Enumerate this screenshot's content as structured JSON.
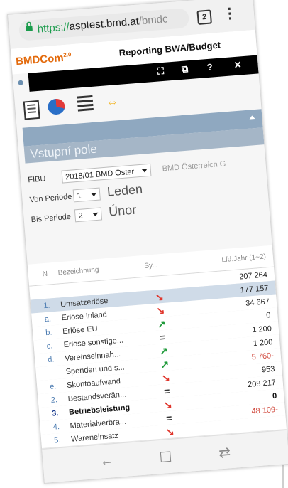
{
  "browser": {
    "url_scheme": "https://",
    "url_host": "asptest.bmd.at",
    "url_path": "/bmdc",
    "tab_count": "2",
    "menu_icon": "kebab-icon"
  },
  "app": {
    "logo_text": "BMDCom",
    "logo_version": "2.0",
    "report_title": "Reporting BWA/Budget",
    "toolbar_icons": [
      "expand-icon",
      "copy-icon",
      "help-icon",
      "close-icon"
    ]
  },
  "tools": {
    "icons": [
      "document-icon",
      "pie-chart-icon",
      "table-icon",
      "swap-arrows-icon"
    ]
  },
  "section": {
    "title": "Vstupní pole"
  },
  "filters": {
    "fibu_label": "FIBU",
    "fibu_value": "2018/01 BMD Öster",
    "company_name": "BMD Österreich G",
    "von_label": "Von Periode",
    "von_value": "1",
    "von_name": "Leden",
    "bis_label": "Bis Periode",
    "bis_value": "2",
    "bis_name": "Únor"
  },
  "table": {
    "headers": {
      "n": "N",
      "name": "Bezeichnung",
      "sy": "Sy...",
      "value": "Lfd.Jahr (1~2)"
    },
    "rows": [
      {
        "n": "",
        "name": "",
        "trend": "",
        "value": "207 264"
      },
      {
        "n": "1.",
        "name": "Umsatzerlöse",
        "trend": "down",
        "value": "177 157"
      },
      {
        "n": "a.",
        "name": "Erlöse Inland",
        "trend": "down",
        "value": "34 667"
      },
      {
        "n": "b.",
        "name": "Erlöse EU",
        "trend": "up",
        "value": "0"
      },
      {
        "n": "c.",
        "name": "Erlöse sonstige...",
        "trend": "eq",
        "value": "1 200"
      },
      {
        "n": "d.",
        "name": "Vereinseinnah...",
        "trend": "up",
        "value": "1 200"
      },
      {
        "n": "",
        "name": "Spenden und s...",
        "trend": "up",
        "value": "5 760-"
      },
      {
        "n": "e.",
        "name": "Skontoaufwand",
        "trend": "down",
        "value": "953"
      },
      {
        "n": "2.",
        "name": "Bestandsverän...",
        "trend": "eq",
        "value": "208 217"
      },
      {
        "n": "3.",
        "name": "Betriebsleistung",
        "trend": "down",
        "value": "0"
      },
      {
        "n": "4.",
        "name": "Materialverbra...",
        "trend": "eq",
        "value": "48 109-"
      },
      {
        "n": "5.",
        "name": "Wareneinsatz",
        "trend": "down",
        "value": ""
      }
    ]
  },
  "navbar": {
    "back": "←",
    "home": "☐",
    "recent": "⇄"
  }
}
